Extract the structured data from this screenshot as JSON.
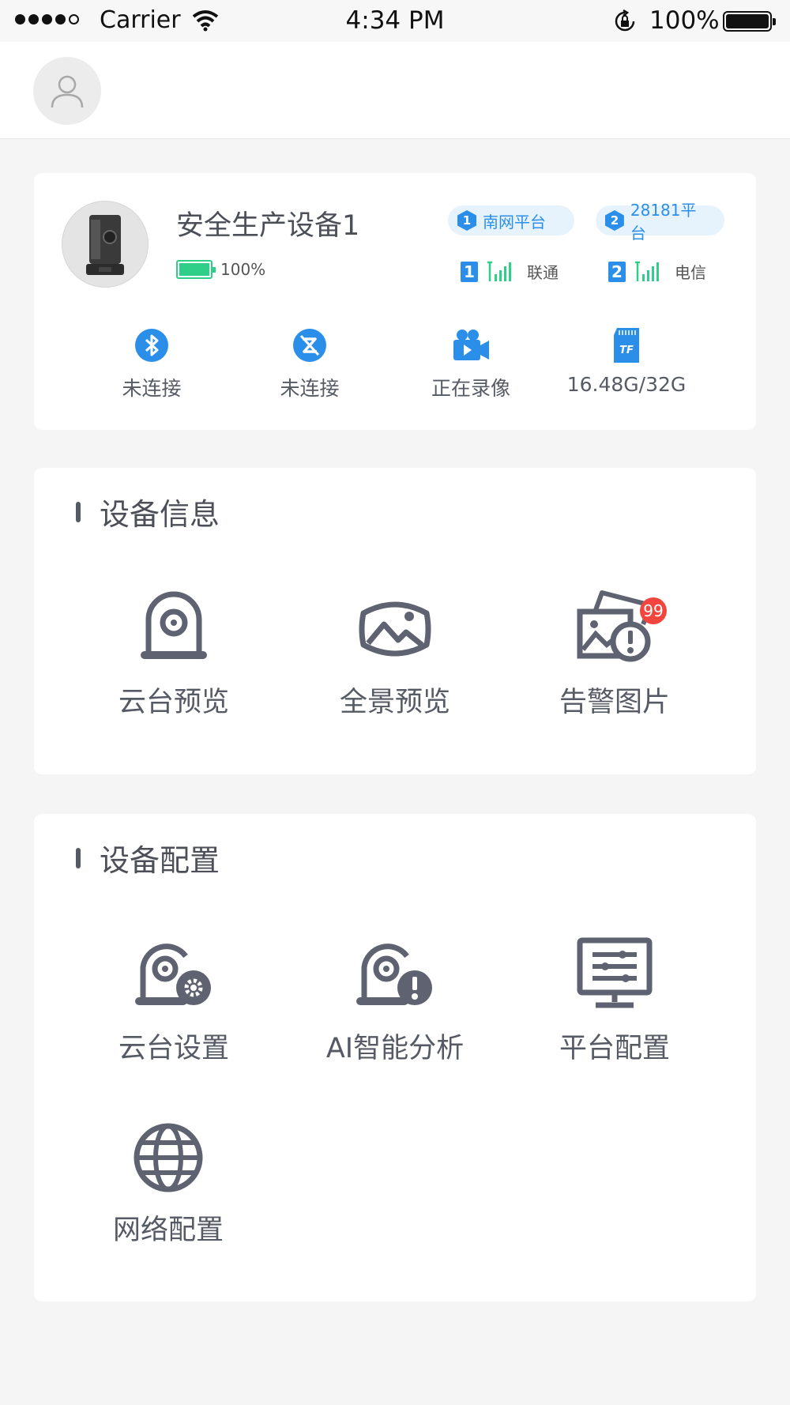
{
  "status_bar": {
    "carrier": "Carrier",
    "time": "4:34 PM",
    "battery": "100%"
  },
  "device": {
    "name": "安全生产设备1",
    "battery": "100%",
    "platforms": [
      {
        "num": "1",
        "label": "南网平台"
      },
      {
        "num": "2",
        "label": "28181平台"
      }
    ],
    "sims": [
      {
        "num": "1",
        "carrier": "联通"
      },
      {
        "num": "2",
        "carrier": "电信"
      }
    ],
    "stats": [
      {
        "icon": "bluetooth-icon",
        "label": "未连接"
      },
      {
        "icon": "link-off-icon",
        "label": "未连接"
      },
      {
        "icon": "video-camera-icon",
        "label": "正在录像"
      },
      {
        "icon": "tf-card-icon",
        "label": "16.48G/32G"
      }
    ]
  },
  "device_info": {
    "title": "设备信息",
    "items": [
      {
        "label": "云台预览"
      },
      {
        "label": "全景预览"
      },
      {
        "label": "告警图片",
        "badge": "99"
      }
    ]
  },
  "device_config": {
    "title": "设备配置",
    "items": [
      {
        "label": "云台设置"
      },
      {
        "label": "AI智能分析"
      },
      {
        "label": "平台配置"
      },
      {
        "label": "网络配置"
      }
    ]
  },
  "colors": {
    "accent": "#2b8fea",
    "battery_green": "#2fcf8a",
    "badge_red": "#f2453d",
    "icon_gray": "#5f6270",
    "background": "#f5f5f5"
  }
}
